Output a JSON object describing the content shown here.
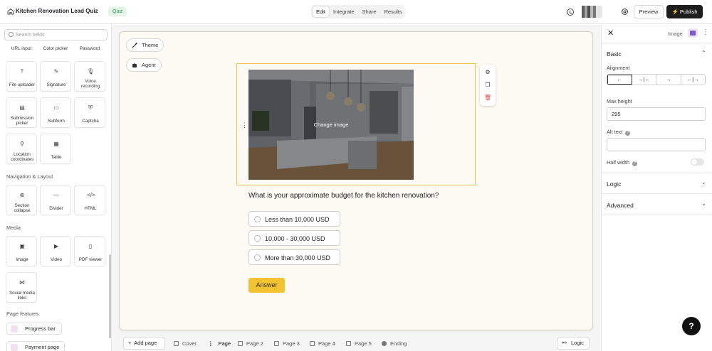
{
  "header": {
    "title": "Kitchen Renovation Lead Quiz",
    "badge": "Quiz",
    "tabs": [
      {
        "label": "Edit",
        "active": true
      },
      {
        "label": "Integrate",
        "active": false
      },
      {
        "label": "Share",
        "active": false
      },
      {
        "label": "Results",
        "active": false
      }
    ],
    "preview_label": "Preview",
    "publish_label": "Publish",
    "icons": {
      "home": "home-icon",
      "chevron": "chevron-down-icon",
      "history": "clock-icon",
      "settings": "gear-icon",
      "publish": "lightning-icon"
    }
  },
  "sidebar": {
    "search_placeholder": "Search fields",
    "top_row": [
      "URL input",
      "Color picker",
      "Password"
    ],
    "fields": [
      {
        "label": "File uploader",
        "icon": "upload-icon"
      },
      {
        "label": "Signature",
        "icon": "pen-icon"
      },
      {
        "label": "Voice recording",
        "icon": "microphone-icon"
      },
      {
        "label": "Submission picker",
        "icon": "list-icon"
      },
      {
        "label": "Subform",
        "icon": "message-icon"
      },
      {
        "label": "Captcha",
        "icon": "shield-icon"
      },
      {
        "label": "Location coordinates",
        "icon": "pin-icon"
      },
      {
        "label": "Table",
        "icon": "table-icon"
      }
    ],
    "nav_section": "Navigation & Layout",
    "nav_fields": [
      {
        "label": "Section collapse",
        "icon": "plus-circle-icon"
      },
      {
        "label": "Divider",
        "icon": "minus-icon"
      },
      {
        "label": "HTML",
        "icon": "code-icon"
      }
    ],
    "media_section": "Media",
    "media_fields": [
      {
        "label": "Image",
        "icon": "image-icon"
      },
      {
        "label": "Video",
        "icon": "video-icon"
      },
      {
        "label": "PDF viewer",
        "icon": "file-icon"
      },
      {
        "label": "Social media links",
        "icon": "share-icon"
      }
    ],
    "page_features_section": "Page features",
    "page_features": [
      "Progress bar",
      "Payment page"
    ]
  },
  "canvas": {
    "theme_label": "Theme",
    "agent_label": "Agent",
    "image_overlay": "Change image",
    "question": "What is your approximate budget for the kitchen renovation?",
    "options": [
      "Less than 10,000 USD",
      "10,000 - 30,000 USD",
      "More than 30,000 USD"
    ],
    "answer_label": "Answer",
    "tool_icons": [
      "gear-icon",
      "copy-icon",
      "trash-icon"
    ]
  },
  "pagebar": {
    "add_page": "Add page",
    "pages": [
      {
        "label": "Cover",
        "active": false
      },
      {
        "label": "Page",
        "active": true
      },
      {
        "label": "Page 2",
        "active": false
      },
      {
        "label": "Page 3",
        "active": false
      },
      {
        "label": "Page 4",
        "active": false
      },
      {
        "label": "Page 5",
        "active": false
      },
      {
        "label": "Ending",
        "active": false
      }
    ],
    "logic_label": "Logic"
  },
  "properties": {
    "type_label": "Image",
    "basic_label": "Basic",
    "alignment_label": "Alignment",
    "alignment_options": [
      "←",
      "→|←",
      "→",
      "←|→"
    ],
    "alignment_selected": 0,
    "max_height_label": "Max height",
    "max_height_value": "295",
    "alt_text_label": "Alt text",
    "alt_text_value": "",
    "half_width_label": "Half width",
    "half_width_on": false,
    "logic_label": "Logic",
    "advanced_label": "Advanced"
  },
  "help_label": "?"
}
